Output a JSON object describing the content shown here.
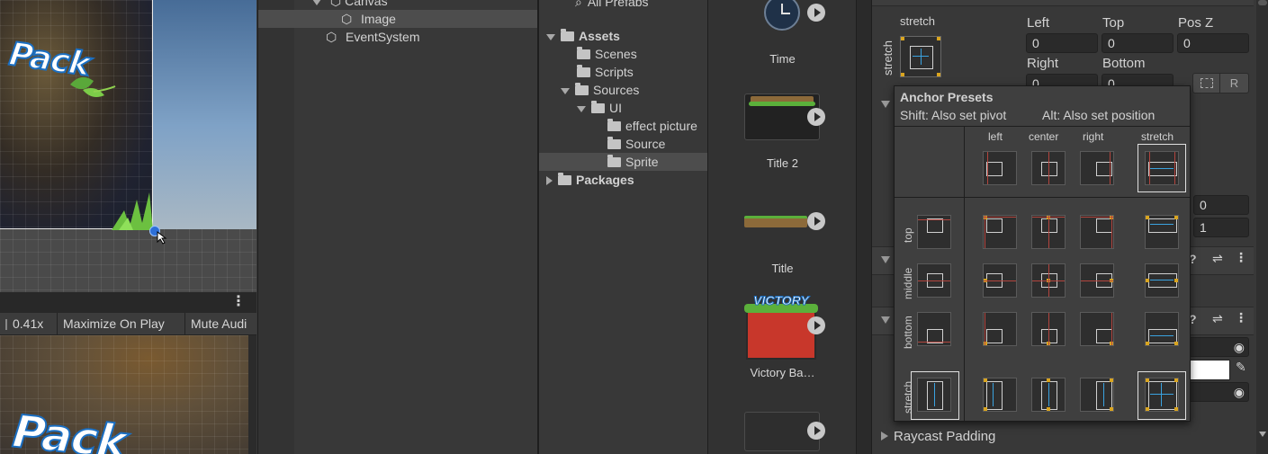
{
  "scene": {
    "logo_text": "Pack",
    "more_icon": "vertical-dots-icon"
  },
  "game_toolbar": {
    "zoom": "0.41x",
    "maximize": "Maximize On Play",
    "mute": "Mute Audi"
  },
  "game": {
    "logo_text": "Pack"
  },
  "hierarchy": {
    "items": [
      {
        "label": "Canvas",
        "icon": "cube-icon"
      },
      {
        "label": "Image",
        "icon": "cube-icon",
        "selected": true
      },
      {
        "label": "EventSystem",
        "icon": "cube-icon"
      }
    ]
  },
  "project": {
    "all_prefabs": "All Prefabs",
    "tree": [
      {
        "label": "Assets",
        "bold": true
      },
      {
        "label": "Scenes"
      },
      {
        "label": "Scripts"
      },
      {
        "label": "Sources"
      },
      {
        "label": "UI"
      },
      {
        "label": "effect picture"
      },
      {
        "label": "Source"
      },
      {
        "label": "Sprite"
      },
      {
        "label": "Packages",
        "bold": true
      }
    ]
  },
  "assets": {
    "items": [
      {
        "label": "Time"
      },
      {
        "label": "Title 2"
      },
      {
        "label": "Title"
      },
      {
        "label": "Victory Ba…",
        "badge": "VICTORY"
      },
      {
        "label": ""
      }
    ]
  },
  "inspector": {
    "anchor_label": "stretch",
    "anchor_side_label": "stretch",
    "fields": {
      "left_label": "Left",
      "left_value": "0",
      "top_label": "Top",
      "top_value": "0",
      "posz_label": "Pos Z",
      "posz_value": "0",
      "right_label": "Right",
      "right_value": "0",
      "bottom_label": "Bottom",
      "bottom_value": "0"
    },
    "side_values": [
      "0",
      "1"
    ],
    "raycast_padding": "Raycast Padding",
    "blueprint_button": "R"
  },
  "anchor_popup": {
    "title": "Anchor Presets",
    "shift_hint": "Shift: Also set pivot",
    "alt_hint": "Alt: Also set position",
    "columns": [
      "left",
      "center",
      "right",
      "stretch"
    ],
    "rows": [
      "top",
      "middle",
      "bottom",
      "stretch"
    ]
  }
}
